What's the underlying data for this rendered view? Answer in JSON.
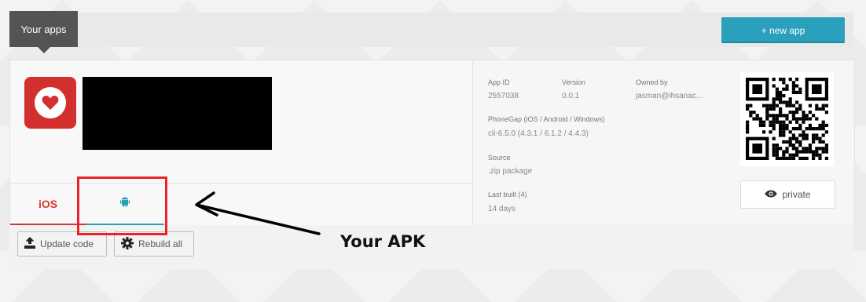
{
  "header": {
    "your_apps_label": "Your apps",
    "new_app_label": "+ new app"
  },
  "app": {
    "icon": "heart-icon",
    "tabs": [
      {
        "label": "iOS",
        "active": true
      },
      {
        "icon": "android-icon"
      }
    ],
    "info": {
      "app_id_label": "App ID",
      "app_id_value": "2557038",
      "version_label": "Version",
      "version_value": "0.0.1",
      "owner_label": "Owned by",
      "owner_value": "jasman@ihsanac...",
      "phonegap_label": "PhoneGap (iOS / Android / Windows)",
      "phonegap_value": "cli-6.5.0 (4.3.1 / 6.1.2 / 4.4.3)",
      "source_label": "Source",
      "source_value": ".zip package",
      "last_built_label": "Last built (4)",
      "last_built_value": "14 days"
    },
    "private_label": "private",
    "private_icon": "eye-icon"
  },
  "actions": {
    "update_code_label": "Update code",
    "update_code_icon": "upload-icon",
    "rebuild_all_label": "Rebuild all",
    "rebuild_all_icon": "gear-icon"
  },
  "annotation": {
    "text": "Your APK"
  },
  "colors": {
    "accent": "#2aa0bc",
    "ios_red": "#d9362b",
    "highlight": "#e8232a",
    "header_dark": "#545454"
  }
}
